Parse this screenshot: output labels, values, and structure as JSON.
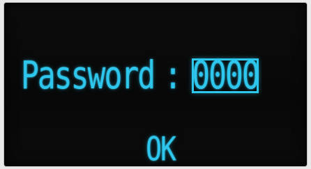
{
  "dialog": {
    "password_label": "Password",
    "separator": ":",
    "password_value": "0000",
    "ok_label": "OK"
  },
  "colors": {
    "text": "#2ec6ec",
    "background": "#0a0a0a"
  }
}
